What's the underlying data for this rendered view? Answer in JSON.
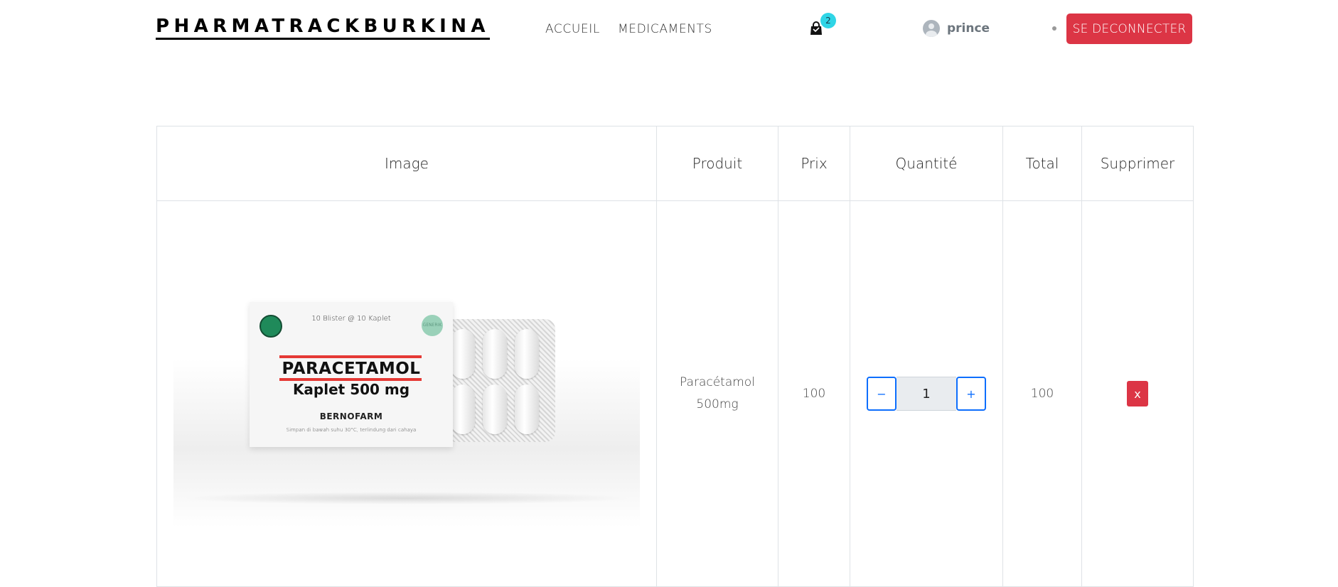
{
  "header": {
    "brand": "PHARMATRACKBURKINA",
    "nav": [
      {
        "label": "ACCUEIL"
      },
      {
        "label": "MEDICAMENTS"
      }
    ],
    "cart_count": "2",
    "cart_icon": "shopping-bag-icon",
    "username": "prince",
    "user_icon": "user-avatar-icon",
    "logout_label": "SE DECONNECTER",
    "logout_color": "#dc3545",
    "badge_color": "#2fd5e6"
  },
  "table": {
    "headers": [
      "Image",
      "Produit",
      "Prix",
      "Quantité",
      "Total",
      "Supprimer"
    ],
    "rows": [
      {
        "product_line1": "Paracétamol",
        "product_line2": "500mg",
        "price": "100",
        "quantity": "1",
        "total": "100",
        "remove_label": "x",
        "decrement_label": "−",
        "increment_label": "+",
        "image": {
          "count_text": "10 Blister @ 10 Kaplet",
          "name": "PARACETAMOL",
          "dose": "Kaplet 500 mg",
          "maker": "BERNOFARM",
          "storage": "Simpan di bawah suhu 30°C, terlindung dari cahaya",
          "badge": "GENERIK"
        }
      }
    ]
  }
}
